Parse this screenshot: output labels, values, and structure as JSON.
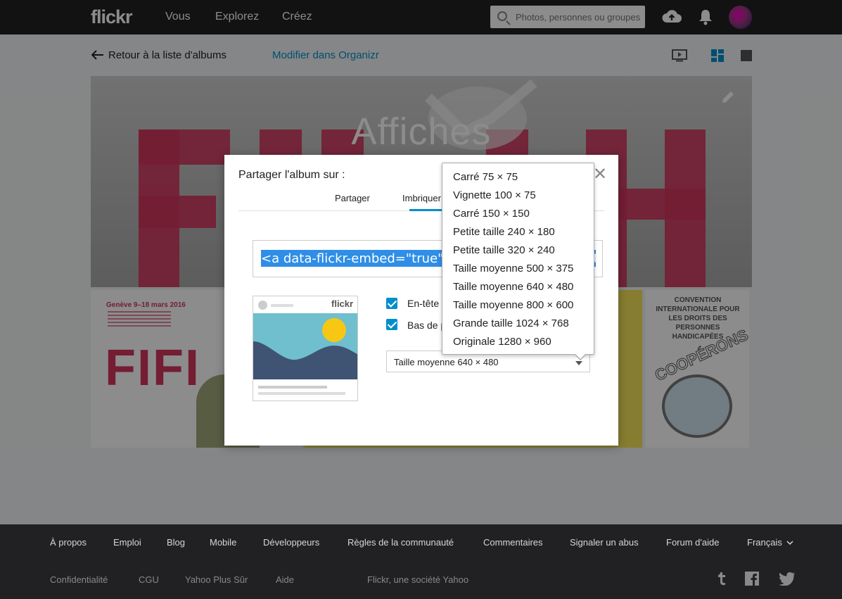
{
  "topnav": {
    "logo": "flickr",
    "links": [
      "Vous",
      "Explorez",
      "Créez"
    ],
    "search_placeholder": "Photos, personnes ou groupes"
  },
  "subheader": {
    "back_label": "Retour à la liste d'albums",
    "organizr_label": "Modifier dans Organizr"
  },
  "hero": {
    "title": "Affiches"
  },
  "dialog": {
    "title": "Partager l'album sur :",
    "tabs": [
      "Partager",
      "Imbriquer"
    ],
    "embed_code": "<a data-flickr-embed=\"true\" data-header=\"true\" data-footer=\"true\" href=\"https://www.flickr.com/photos/",
    "checkbox_header": "En-tête",
    "checkbox_footer": "Bas de page",
    "size_selected": "Taille moyenne 640 × 480"
  },
  "dropdown": {
    "options": [
      "Carré 75 × 75",
      "Vignette 100 × 75",
      "Carré 150 × 150",
      "Petite taille 240 × 180",
      "Petite taille 320 × 240",
      "Taille moyenne 500 × 375",
      "Taille moyenne 640 × 480",
      "Taille moyenne 800 × 600",
      "Grande taille 1024 × 768",
      "Originale 1280 × 960"
    ]
  },
  "thumbs": {
    "poster1_date": "Genève 9–18 mars 2016",
    "poster1_word": "FIFI",
    "poster3_title": "CONVENTION INTERNATIONALE POUR LES DROITS DES PERSONNES HANDICAPÉES",
    "poster3_word": "COOPÉRONS..."
  },
  "footer": {
    "row1": [
      "À propos",
      "Emploi",
      "Blog",
      "Mobile",
      "Développeurs",
      "Règles de la communauté",
      "Commentaires",
      "Signaler un abus",
      "Forum d'aide",
      "Français"
    ],
    "row2": [
      "Confidentialité",
      "CGU",
      "Yahoo Plus Sûr",
      "Aide"
    ],
    "company": "Flickr, une société Yahoo"
  },
  "colors": {
    "accent": "#008ecd",
    "selection": "#2f8ee6",
    "poster_red": "#d4365e"
  }
}
